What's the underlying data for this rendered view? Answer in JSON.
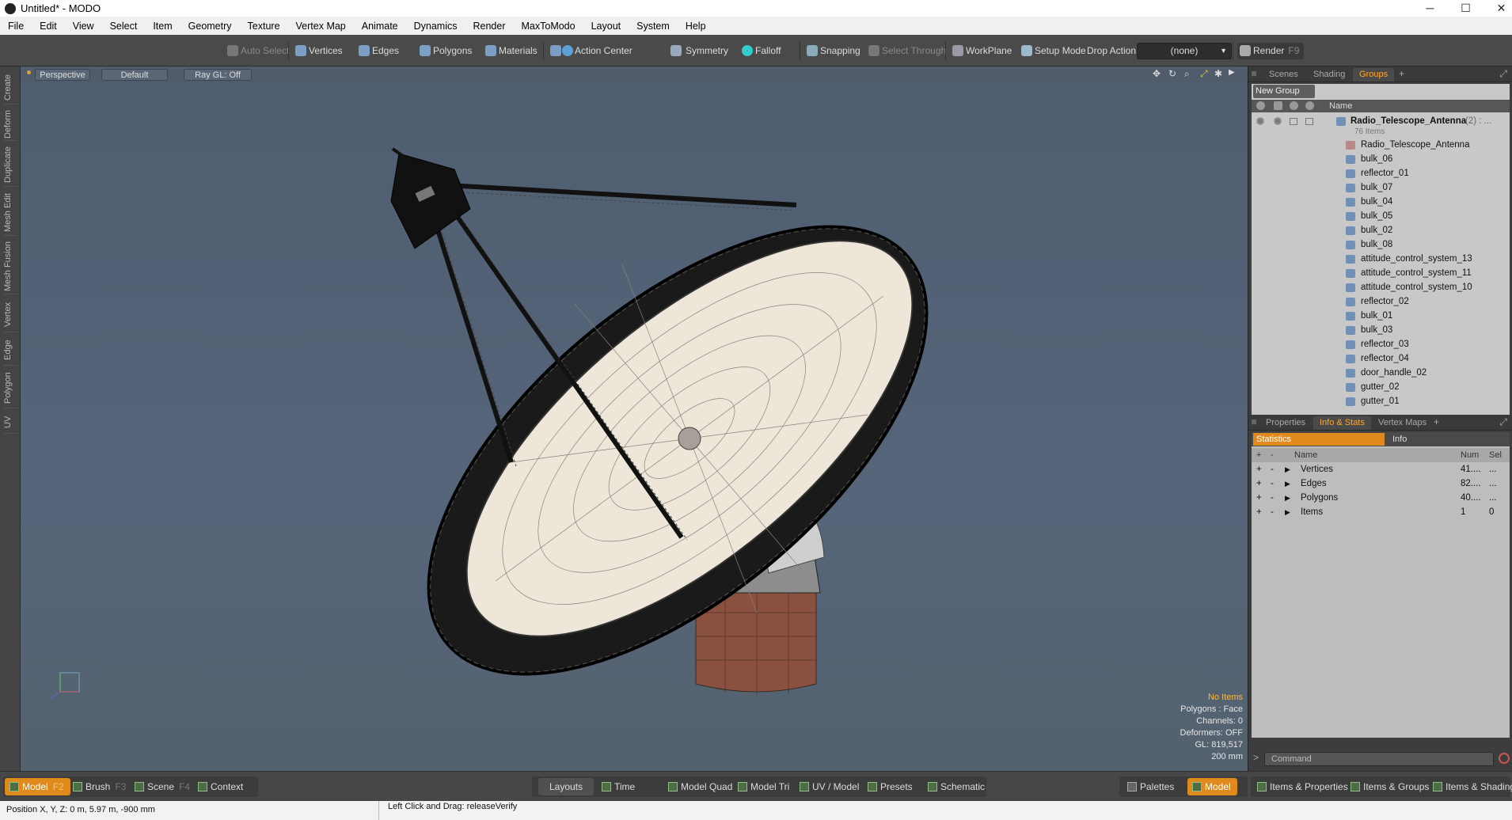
{
  "title": "Untitled* - MODO",
  "window_controls": {
    "minimize": "─",
    "maximize": "☐",
    "close": "✕"
  },
  "menu": [
    "File",
    "Edit",
    "View",
    "Select",
    "Item",
    "Geometry",
    "Texture",
    "Vertex Map",
    "Animate",
    "Dynamics",
    "Render",
    "MaxToModo",
    "Layout",
    "System",
    "Help"
  ],
  "toolbar": {
    "auto_select": "Auto Select",
    "vertices": "Vertices",
    "edges": "Edges",
    "polygons": "Polygons",
    "materials": "Materials",
    "action_center": "Action Center",
    "symmetry": "Symmetry",
    "falloff": "Falloff",
    "snapping": "Snapping",
    "select_through": "Select Through",
    "workplane": "WorkPlane",
    "setup_mode": "Setup Mode",
    "drop_action": "Drop Action",
    "drop_action_value": "(none)",
    "render": "Render",
    "render_key": "F9"
  },
  "left_tabs": [
    "Create",
    "Deform",
    "Duplicate",
    "Mesh Edit",
    "Mesh Fusion",
    "Vertex",
    "Edge",
    "Polygon",
    "UV"
  ],
  "viewport": {
    "view": "Perspective",
    "shading": "Default",
    "raygl": "Ray GL: Off",
    "overlay": {
      "no_items": "No Items",
      "polygons": "Polygons : Face",
      "channels": "Channels: 0",
      "deformers": "Deformers: OFF",
      "gl": "GL: 819,517",
      "scale": "200 mm"
    }
  },
  "groups_panel": {
    "tabs": [
      "Scenes",
      "Shading",
      "Groups"
    ],
    "new_group": "New Group",
    "column_name": "Name",
    "root": {
      "name": "Radio_Telescope_Antenna",
      "suffix": "(2) : ...",
      "count": "76 Items"
    },
    "items": [
      "Radio_Telescope_Antenna",
      "bulk_06",
      "reflector_01",
      "bulk_07",
      "bulk_04",
      "bulk_05",
      "bulk_02",
      "bulk_08",
      "attitude_control_system_13",
      "attitude_control_system_11",
      "attitude_control_system_10",
      "reflector_02",
      "bulk_01",
      "bulk_03",
      "reflector_03",
      "reflector_04",
      "door_handle_02",
      "gutter_02",
      "gutter_01"
    ]
  },
  "stats_panel": {
    "tabs": [
      "Properties",
      "Info & Stats",
      "Vertex Maps"
    ],
    "subtabs": [
      "Statistics",
      "Info"
    ],
    "columns": {
      "name": "Name",
      "num": "Num",
      "sel": "Sel"
    },
    "rows": [
      {
        "name": "Vertices",
        "num": "41....",
        "sel": "..."
      },
      {
        "name": "Edges",
        "num": "82....",
        "sel": "..."
      },
      {
        "name": "Polygons",
        "num": "40....",
        "sel": "..."
      },
      {
        "name": "Items",
        "num": "1",
        "sel": "0"
      }
    ],
    "command_placeholder": "Command"
  },
  "bottom": {
    "model": "Model",
    "model_key": "F2",
    "brush": "Brush",
    "brush_key": "F3",
    "scene": "Scene",
    "scene_key": "F4",
    "context": "Context",
    "layouts": "Layouts",
    "time": "Time",
    "model_quad": "Model Quad",
    "model_tri": "Model Tri",
    "uv_model": "UV / Model",
    "presets": "Presets",
    "schematic": "Schematic",
    "palettes": "Palettes",
    "model_right": "Model",
    "items_properties": "Items & Properties",
    "items_groups": "Items & Groups",
    "items_shading": "Items & Shading"
  },
  "status": {
    "position": "Position X, Y, Z:  0 m, 5.97 m, -900 mm",
    "hint": "Left Click and Drag:   releaseVerify"
  }
}
